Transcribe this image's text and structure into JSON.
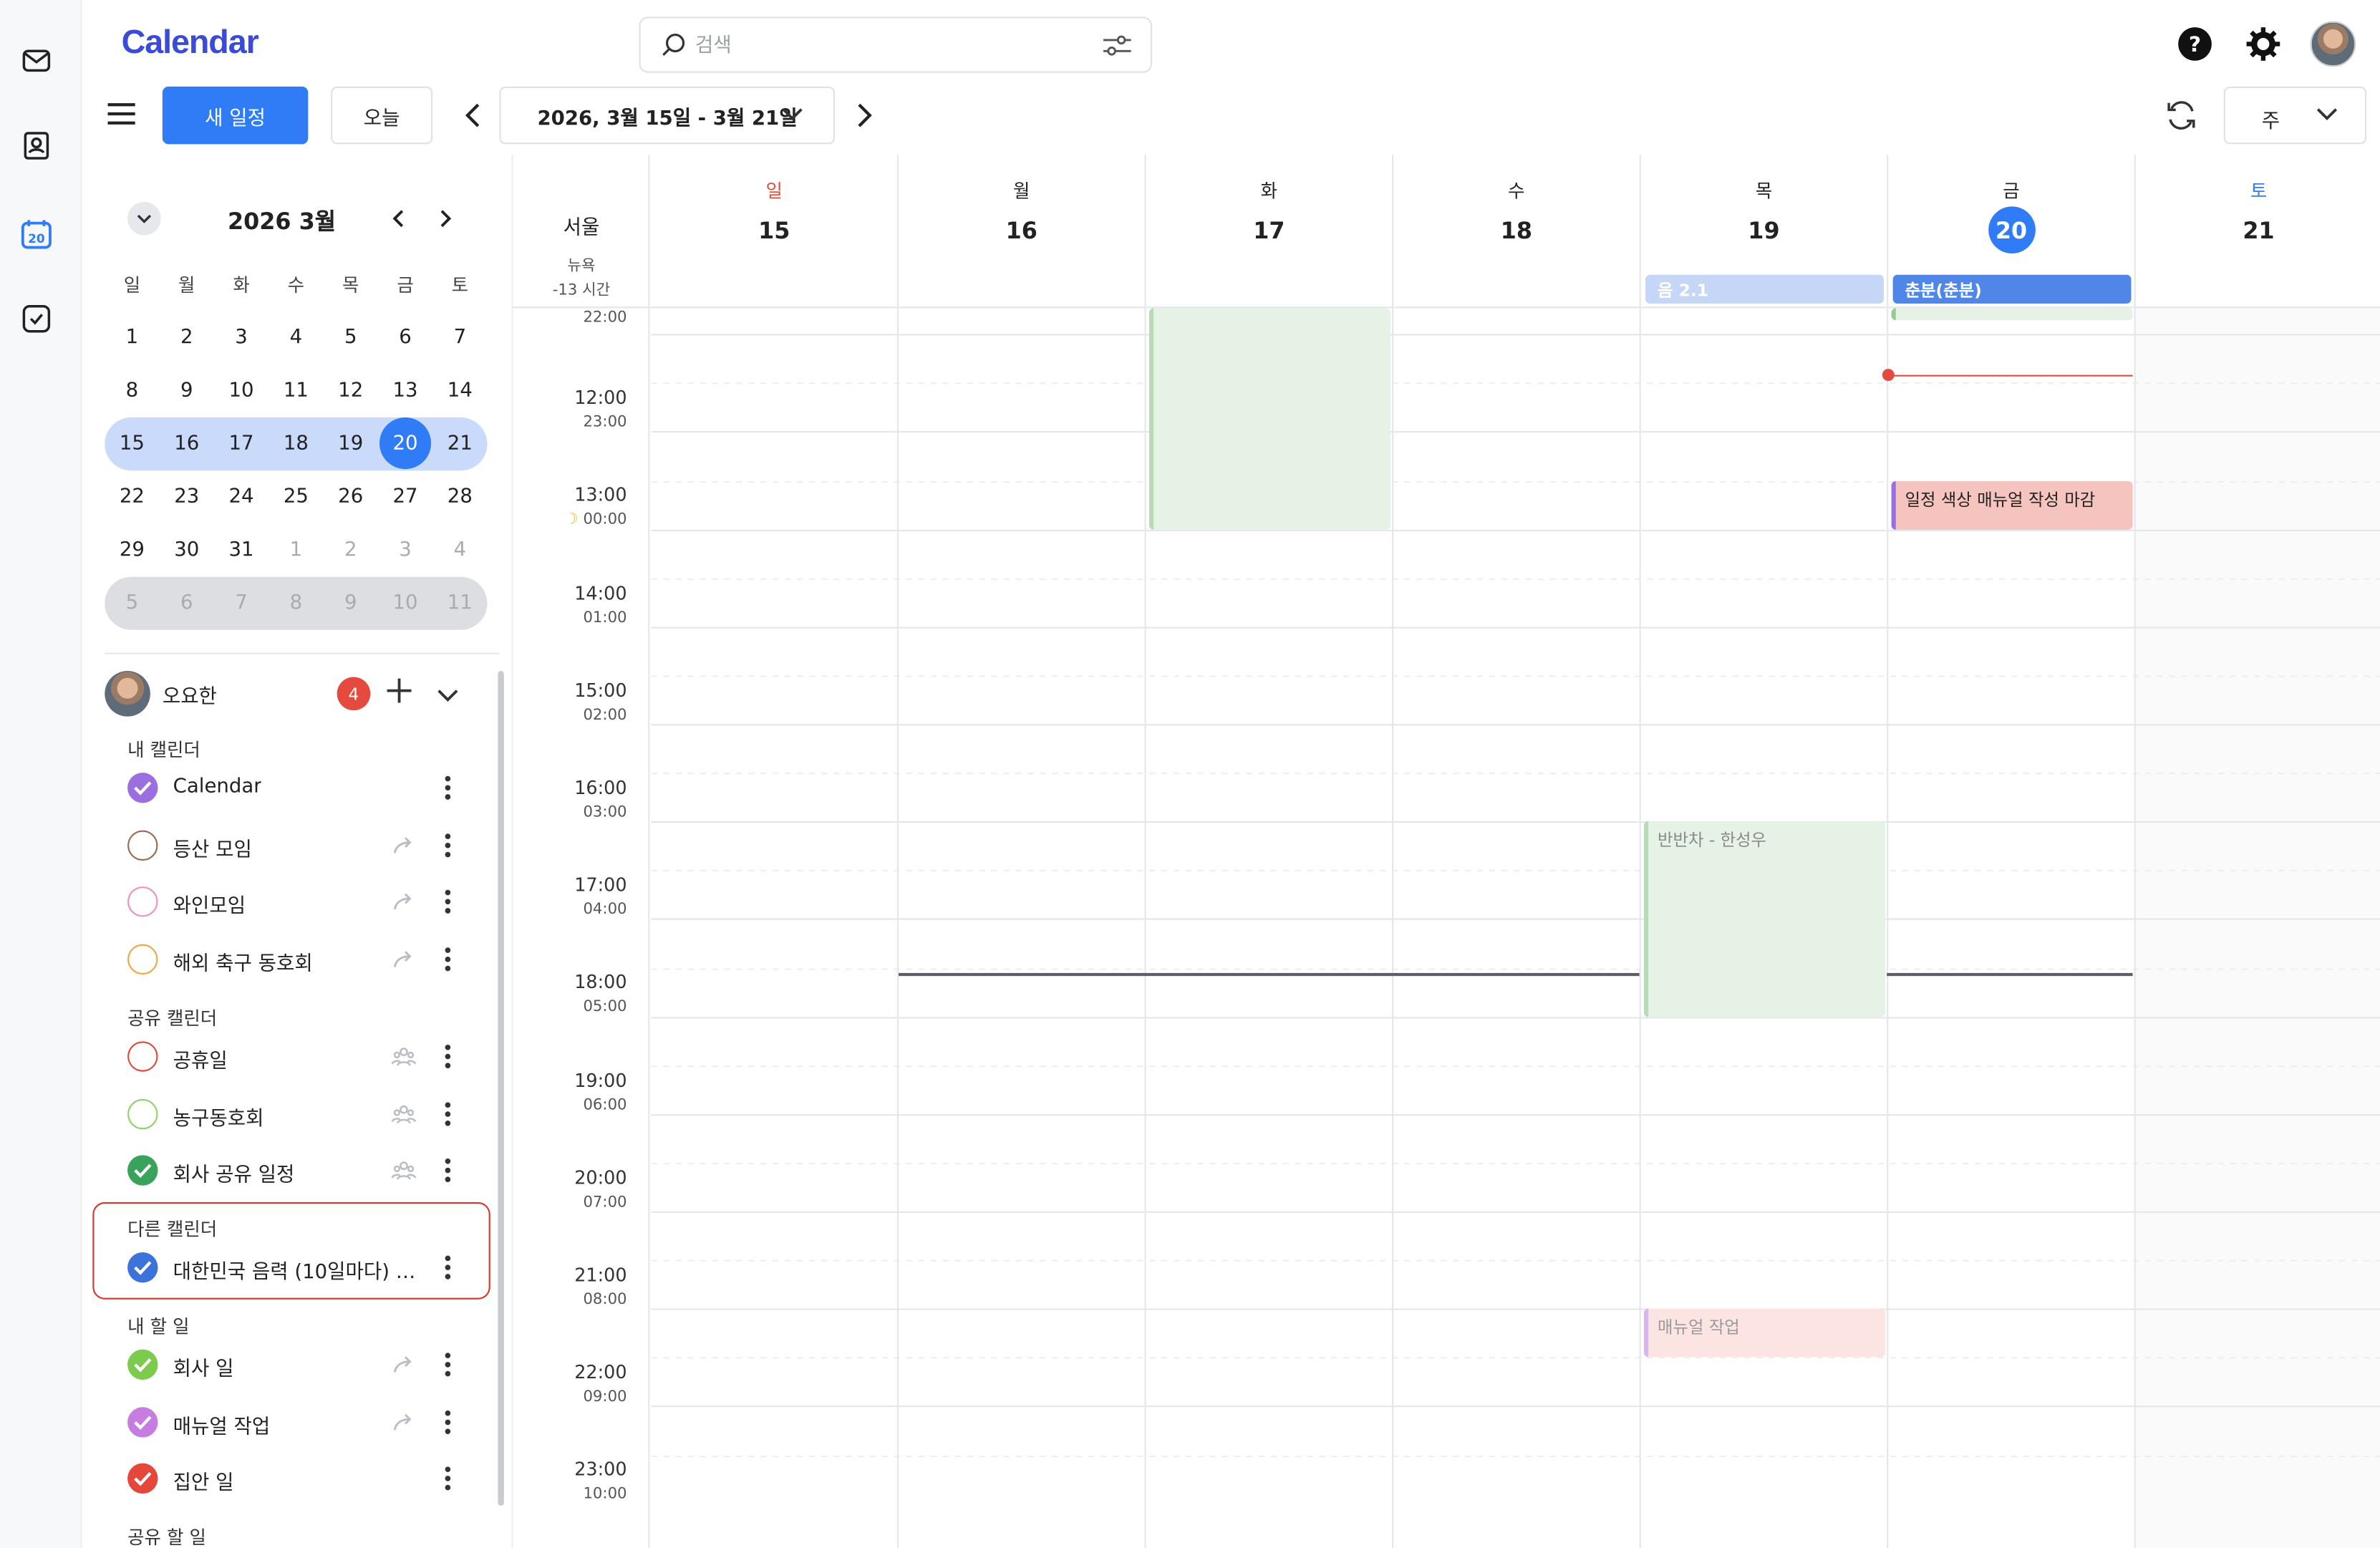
{
  "app": {
    "title": "Calendar"
  },
  "search": {
    "placeholder": "검색"
  },
  "toolbar": {
    "new_event": "새 일정",
    "today": "오늘",
    "range": "2026, 3월 15일 - 3월 21일",
    "view": "주"
  },
  "mini_cal": {
    "title": "2026 3월",
    "weekday_headers": [
      "일",
      "월",
      "화",
      "수",
      "목",
      "금",
      "토"
    ],
    "weeks": [
      [
        "1",
        "2",
        "3",
        "4",
        "5",
        "6",
        "7"
      ],
      [
        "8",
        "9",
        "10",
        "11",
        "12",
        "13",
        "14"
      ],
      [
        "15",
        "16",
        "17",
        "18",
        "19",
        "20",
        "21"
      ],
      [
        "22",
        "23",
        "24",
        "25",
        "26",
        "27",
        "28"
      ],
      [
        "29",
        "30",
        "31",
        "1",
        "2",
        "3",
        "4"
      ],
      [
        "5",
        "6",
        "7",
        "8",
        "9",
        "10",
        "11"
      ]
    ],
    "today": "20"
  },
  "user": {
    "name": "오요한",
    "badge": "4"
  },
  "sections": {
    "my_calendars": "내 캘린더",
    "shared_calendars": "공유 캘린더",
    "other_calendars": "다른 캘린더",
    "my_todos": "내 할 일",
    "shared_todos": "공유 할 일"
  },
  "my_calendars": [
    {
      "label": "Calendar",
      "color": "#9c6fe0",
      "checked": true
    },
    {
      "label": "등산 모임",
      "color": "#9a6a4e",
      "checked": false
    },
    {
      "label": "와인모임",
      "color": "#f08fbf",
      "checked": false
    },
    {
      "label": "해외 축구 동호회",
      "color": "#f0a640",
      "checked": false
    }
  ],
  "shared_calendars": [
    {
      "label": "공휴일",
      "color": "#e5473a",
      "checked": false
    },
    {
      "label": "농구동호회",
      "color": "#8fd16b",
      "checked": false
    },
    {
      "label": "회사 공유 일정",
      "color": "#3aa35b",
      "checked": true
    }
  ],
  "other_calendars": [
    {
      "label": "대한민국 음력 (10일마다) 및 24절기",
      "color": "#3b73db",
      "checked": true
    }
  ],
  "my_todos": [
    {
      "label": "회사 일",
      "color": "#7ccb4d",
      "checked": true
    },
    {
      "label": "매뉴얼 작업",
      "color": "#c77ce0",
      "checked": true
    },
    {
      "label": "집안 일",
      "color": "#e5473a",
      "checked": true
    }
  ],
  "timezone": {
    "primary": "서울",
    "secondary": "뉴욕",
    "offset": "-13 시간"
  },
  "days": [
    {
      "name": "일",
      "date": "15"
    },
    {
      "name": "월",
      "date": "16"
    },
    {
      "name": "화",
      "date": "17"
    },
    {
      "name": "수",
      "date": "18"
    },
    {
      "name": "목",
      "date": "19"
    },
    {
      "name": "금",
      "date": "20"
    },
    {
      "name": "토",
      "date": "21"
    }
  ],
  "times": [
    {
      "main": "",
      "sub": "22:00"
    },
    {
      "main": "12:00",
      "sub": "23:00"
    },
    {
      "main": "13:00",
      "sub": "00:00"
    },
    {
      "main": "14:00",
      "sub": "01:00"
    },
    {
      "main": "15:00",
      "sub": "02:00"
    },
    {
      "main": "16:00",
      "sub": "03:00"
    },
    {
      "main": "17:00",
      "sub": "04:00"
    },
    {
      "main": "18:00",
      "sub": "05:00"
    },
    {
      "main": "19:00",
      "sub": "06:00"
    },
    {
      "main": "20:00",
      "sub": "07:00"
    },
    {
      "main": "21:00",
      "sub": "08:00"
    },
    {
      "main": "22:00",
      "sub": "09:00"
    },
    {
      "main": "23:00",
      "sub": "10:00"
    }
  ],
  "allday_events": [
    {
      "label": "음 2.1",
      "day": "19"
    },
    {
      "label": "춘분(춘분)",
      "day": "20"
    }
  ],
  "events": [
    {
      "label": "",
      "day": "17",
      "start": "11:00",
      "end": "14:00"
    },
    {
      "label": "",
      "day": "20",
      "start": "11:00",
      "end": "11:30"
    },
    {
      "label": "일정 색상 매뉴얼 작성 마감",
      "day": "20",
      "start": "13:30",
      "end": "14:00"
    },
    {
      "label": "반반차 - 한성우",
      "day": "19",
      "start": "17:00",
      "end": "19:00"
    },
    {
      "label": "매뉴얼 작업",
      "day": "19",
      "start": "22:00",
      "end": "22:30"
    }
  ],
  "colors": {
    "accent": "#2f7cf6",
    "brand": "#3a4bd8",
    "highlight": "#d8362d"
  }
}
